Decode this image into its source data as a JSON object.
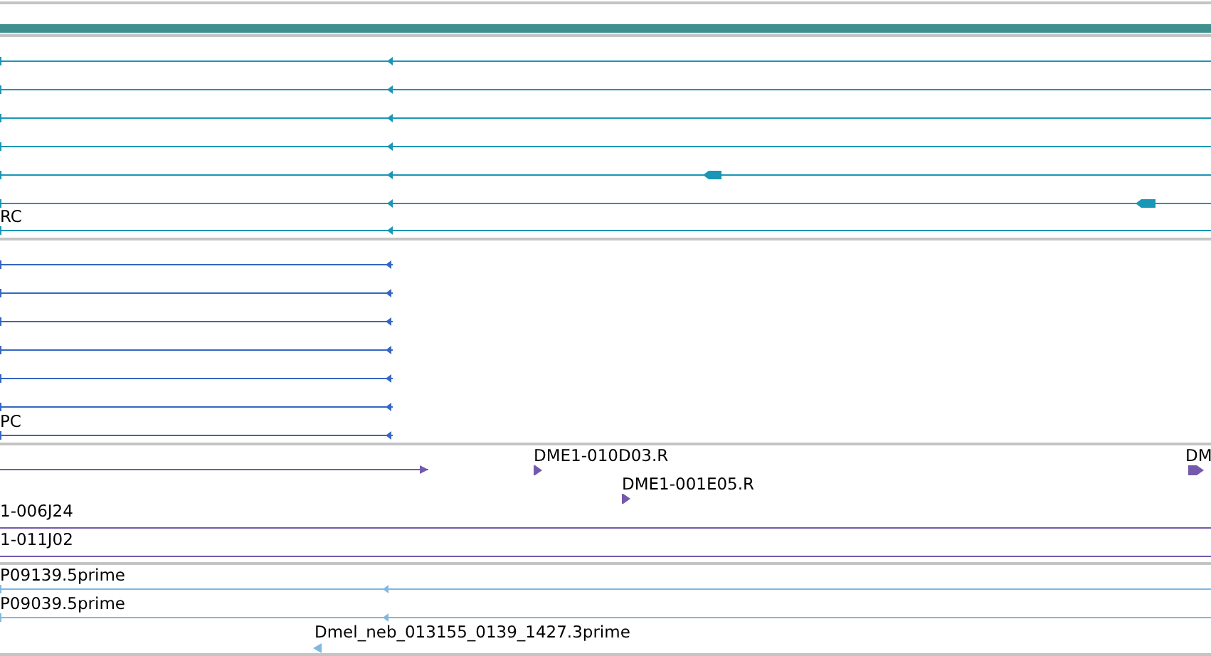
{
  "tracks": [
    {
      "color": "#1a96b6",
      "features": [
        {
          "kind": "transcript"
        },
        {
          "kind": "transcript"
        },
        {
          "kind": "transcript"
        },
        {
          "kind": "transcript"
        },
        {
          "kind": "transcript"
        },
        {
          "kind": "transcript"
        },
        {
          "kind": "transcript",
          "label": "RC"
        }
      ]
    },
    {
      "color": "#3566c4",
      "features": [
        {
          "kind": "transcript"
        },
        {
          "kind": "transcript"
        },
        {
          "kind": "transcript"
        },
        {
          "kind": "transcript"
        },
        {
          "kind": "transcript"
        },
        {
          "kind": "transcript"
        },
        {
          "kind": "transcript",
          "label": "PC"
        }
      ]
    },
    {
      "color": "#7559ad",
      "features": [
        {
          "kind": "transcript"
        },
        {
          "kind": "read",
          "label": "DME1-010D03.R"
        },
        {
          "kind": "read",
          "label": "DME1-001E05.R"
        },
        {
          "kind": "read",
          "label": "DM"
        },
        {
          "kind": "transcript",
          "label": "1-006J24"
        },
        {
          "kind": "transcript",
          "label": "1-011J02"
        }
      ]
    },
    {
      "color": "#80b8e0",
      "features": [
        {
          "kind": "transcript",
          "label": "P09139.5prime"
        },
        {
          "kind": "transcript",
          "label": "P09039.5prime"
        },
        {
          "kind": "read",
          "label": "Dmel_neb_013155_0139_1427.3prime"
        }
      ]
    }
  ]
}
